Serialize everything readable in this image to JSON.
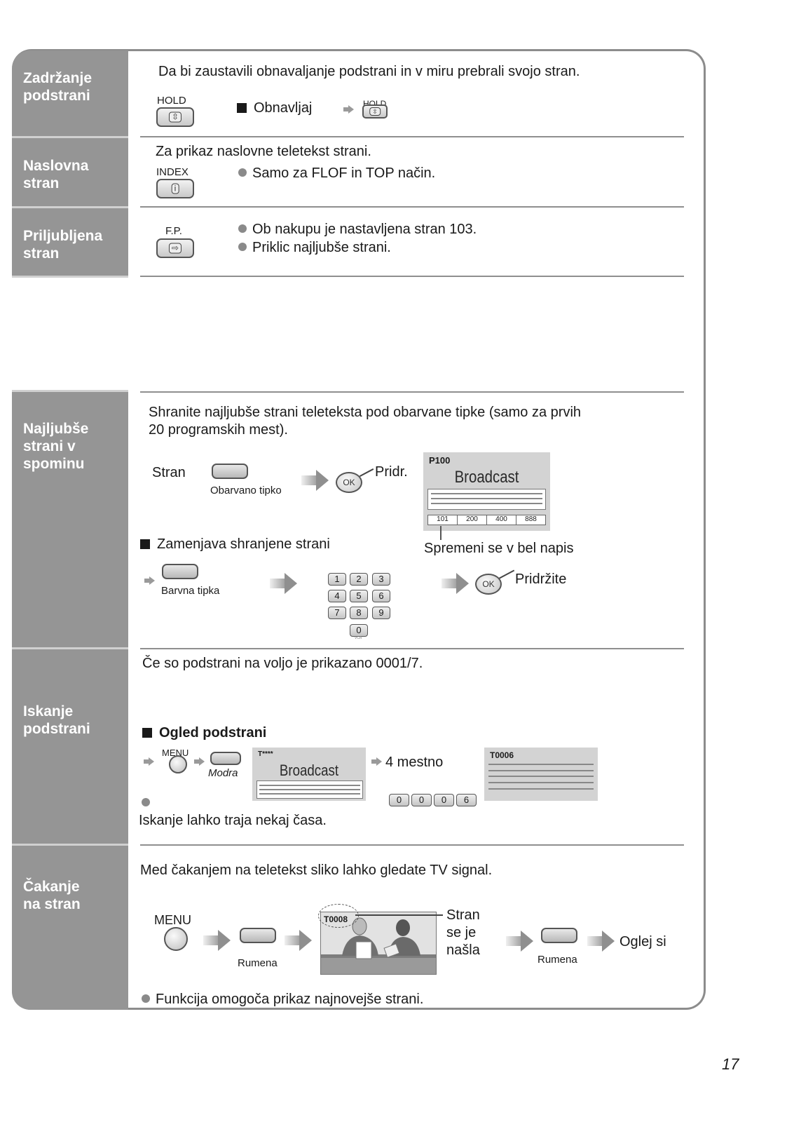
{
  "page_number": "17",
  "sections": [
    {
      "title_lines": [
        "Zadržanje",
        "podstrani"
      ],
      "intro": "Da bi zaustavili obnavaljanje podstrani in v miru prebrali svojo stran.",
      "button_label": "HOLD",
      "sub_label": "Obnavljaj",
      "small_button_label": "HOLD"
    },
    {
      "title_lines": [
        "Naslovna",
        "stran"
      ],
      "intro": "Za prikaz naslovne teletekst strani.",
      "button_label": "INDEX",
      "note": "Samo za FLOF in TOP način."
    },
    {
      "title_lines": [
        "Priljubljena",
        "stran"
      ],
      "button_label": "F.P.",
      "notes": [
        "Ob nakupu je nastavljena stran 103.",
        "Priklic najljubše strani."
      ]
    },
    {
      "title_lines": [
        "Najljubše",
        "strani v",
        "spominu"
      ],
      "intro_lines": [
        "Shranite najljubše strani teleteksta pod obarvane tipke (samo za prvih",
        "20 programskih mest)."
      ],
      "step_label": "Stran",
      "color_key_caption": "Obarvano tipko",
      "ok_label": "OK",
      "hold_label": "Pridr.",
      "screen": {
        "page_code": "P100",
        "headline": "Broadcast",
        "fastext": [
          "101",
          "200",
          "400",
          "888"
        ]
      },
      "screen_callout": "Spremeni se v bel napis",
      "replace_heading": "Zamenjava shranjene strani",
      "color_key_caption_2": "Barvna tipka",
      "keypad": [
        "1",
        "2",
        "3",
        "4",
        "5",
        "6",
        "7",
        "8",
        "9",
        "0"
      ],
      "keypad_sublabel": "VCR",
      "hold_label_2": "Pridržite"
    },
    {
      "title_lines": [
        "Iskanje",
        "podstrani"
      ],
      "intro": "Če so podstrani na voljo je prikazano 0001/7.",
      "sub_heading": "Ogled podstrani",
      "menu_label": "MENU",
      "blue_label": "Modra",
      "screen_code": "T****",
      "screen_headline": "Broadcast",
      "digits_label": "4 mestno",
      "digits": [
        "0",
        "0",
        "0",
        "6"
      ],
      "result_code": "T0006",
      "note": "Iskanje lahko traja nekaj časa."
    },
    {
      "title_lines": [
        "Čakanje",
        "na stran"
      ],
      "intro": "Med čakanjem na teletekst sliko lahko gledate TV signal.",
      "menu_label": "MENU",
      "yellow_label": "Rumena",
      "tv_code": "T0008",
      "found_lines": [
        "Stran",
        "se je",
        "našla"
      ],
      "yellow_label_2": "Rumena",
      "final_label": "Oglej si",
      "note": "Funkcija omogoča prikaz najnovejše strani."
    }
  ]
}
